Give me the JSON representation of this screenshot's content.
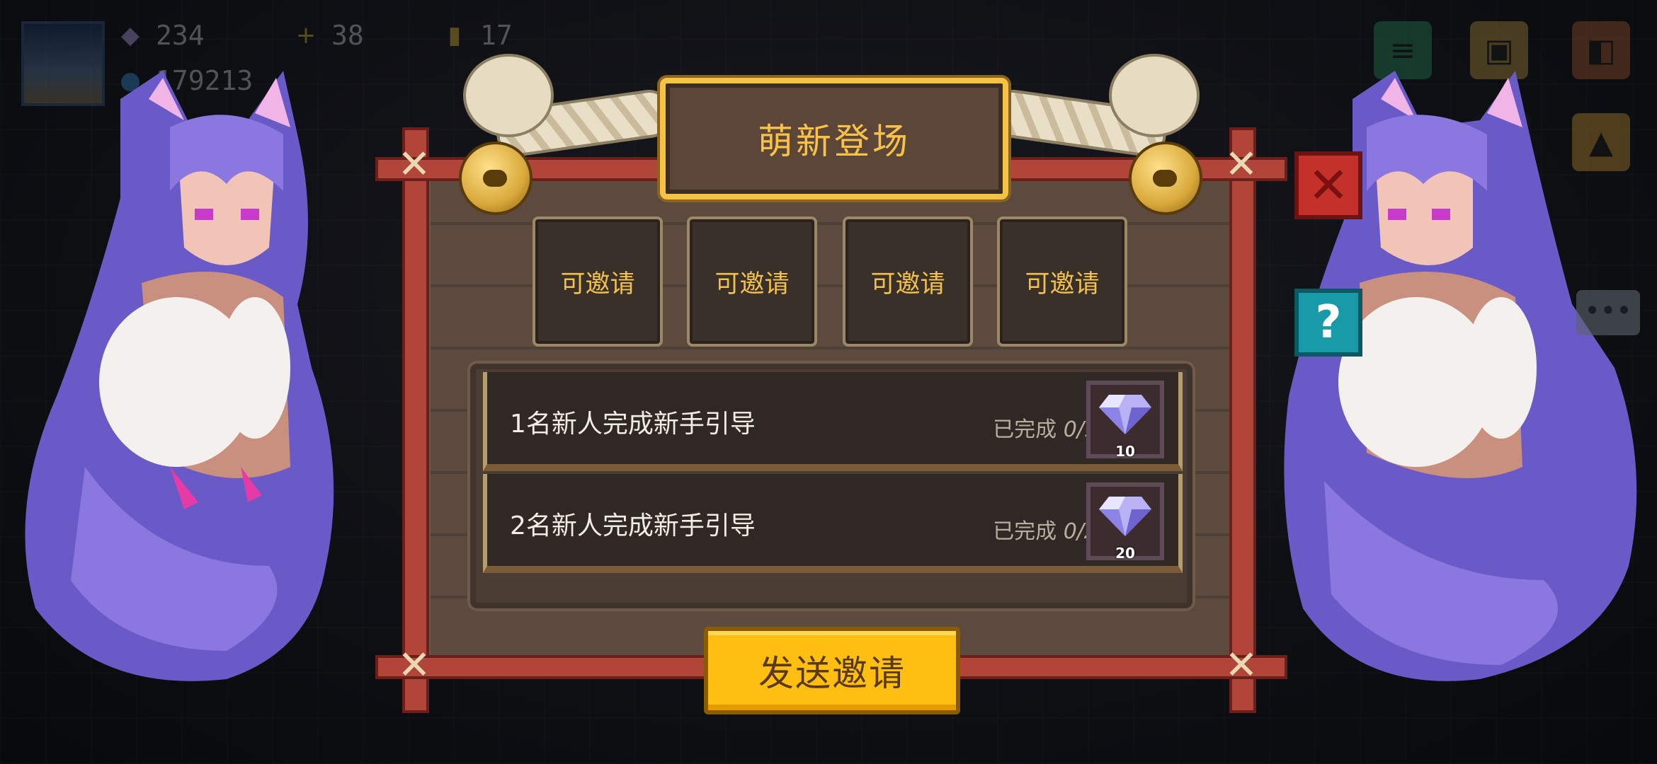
{
  "hud": {
    "gems": "234",
    "coins": "179213",
    "count_a": "38",
    "count_b": "17"
  },
  "dialog": {
    "title": "萌新登场",
    "slots": [
      {
        "label": "可邀请"
      },
      {
        "label": "可邀请"
      },
      {
        "label": "可邀请"
      },
      {
        "label": "可邀请"
      }
    ],
    "tasks": [
      {
        "label": "1名新人完成新手引导",
        "status": "已完成",
        "progress": "0/1",
        "reward_qty": "10"
      },
      {
        "label": "2名新人完成新手引导",
        "status": "已完成",
        "progress": "0/2",
        "reward_qty": "20"
      }
    ],
    "send_button": "发送邀请",
    "close_icon": "close-icon",
    "help_icon": "help-icon"
  },
  "colors": {
    "accent_gold": "#f8c24a",
    "button_yellow": "#ffbe12",
    "frame_red": "#b2453a",
    "close_red": "#c4312b",
    "help_teal": "#199aa8"
  }
}
